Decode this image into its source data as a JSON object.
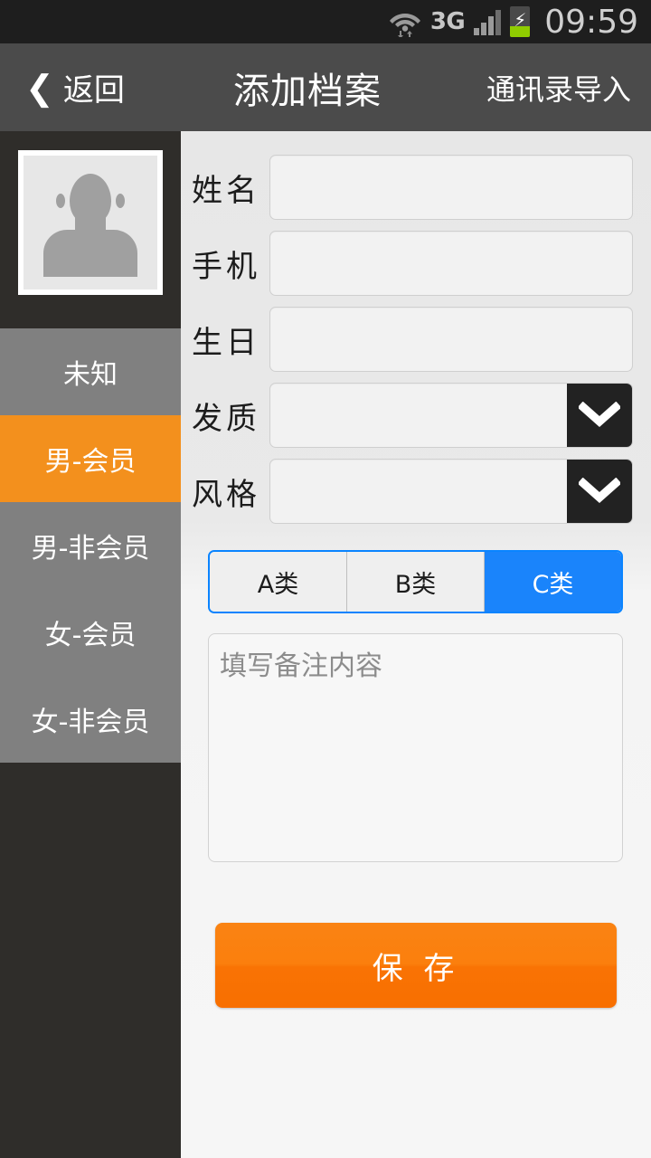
{
  "status_bar": {
    "network_label": "3G",
    "time": "09:59",
    "icons": [
      "wifi-icon",
      "data-transfer-icon",
      "signal-icon",
      "battery-charging-icon"
    ],
    "battery_color": "#8fcc00"
  },
  "header": {
    "back_label": "返回",
    "title": "添加档案",
    "action_label": "通讯录导入",
    "background": "#4b4b4b"
  },
  "sidebar": {
    "avatar_alt": "默认头像",
    "background": "#2f2d2a",
    "item_background": "#808080",
    "selected_background": "#f3901d",
    "items": [
      {
        "label": "未知",
        "selected": false
      },
      {
        "label": "男-会员",
        "selected": true
      },
      {
        "label": "男-非会员",
        "selected": false
      },
      {
        "label": "女-会员",
        "selected": false
      },
      {
        "label": "女-非会员",
        "selected": false
      }
    ]
  },
  "form": {
    "fields": [
      {
        "label": "姓名",
        "value": "",
        "type": "text"
      },
      {
        "label": "手机",
        "value": "",
        "type": "text"
      },
      {
        "label": "生日",
        "value": "",
        "type": "text"
      },
      {
        "label": "发质",
        "value": "",
        "type": "select"
      },
      {
        "label": "风格",
        "value": "",
        "type": "select"
      }
    ],
    "segmented": {
      "options": [
        "A类",
        "B类",
        "C类"
      ],
      "selected_index": 2,
      "accent_color": "#1a84fb"
    },
    "notes": {
      "value": "",
      "placeholder": "填写备注内容"
    },
    "save_label": "保 存",
    "save_color": "#f97b0a"
  }
}
